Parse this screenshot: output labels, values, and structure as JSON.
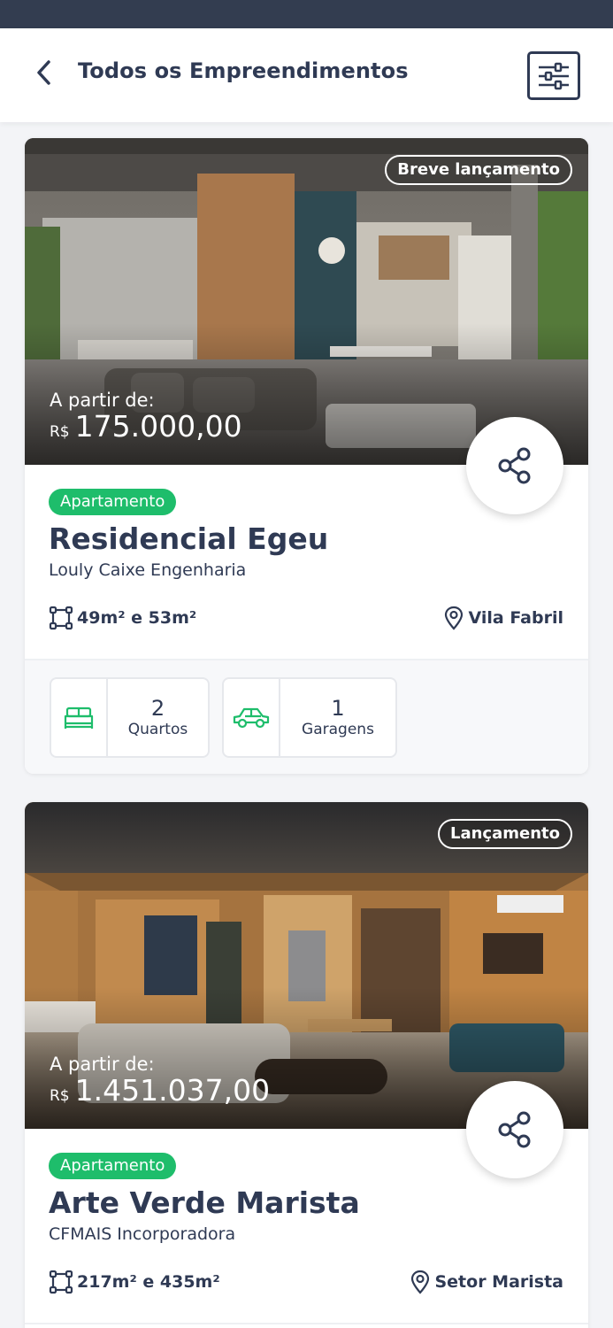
{
  "header": {
    "title": "Todos os Empreendimentos",
    "back_icon": "chevron-left-icon",
    "filter_icon": "sliders-icon"
  },
  "colors": {
    "status_bar": "#333d50",
    "text_primary": "#2f3a54",
    "accent_green": "#1ebd6b"
  },
  "listings": [
    {
      "badge": "Breve lançamento",
      "price_label": "A partir de:",
      "currency": "R$",
      "price": "175.000,00",
      "type": "Apartamento",
      "name": "Residencial Egeu",
      "developer": "Louly Caixe Engenharia",
      "area": "49m² e 53m²",
      "location": "Vila Fabril",
      "features": [
        {
          "icon": "bed-icon",
          "value": "2",
          "label": "Quartos"
        },
        {
          "icon": "car-icon",
          "value": "1",
          "label": "Garagens"
        }
      ]
    },
    {
      "badge": "Lançamento",
      "price_label": "A partir de:",
      "currency": "R$",
      "price": "1.451.037,00",
      "type": "Apartamento",
      "name": "Arte Verde Marista",
      "developer": "CFMAIS Incorporadora",
      "area": "217m² e 435m²",
      "location": "Setor Marista"
    }
  ]
}
